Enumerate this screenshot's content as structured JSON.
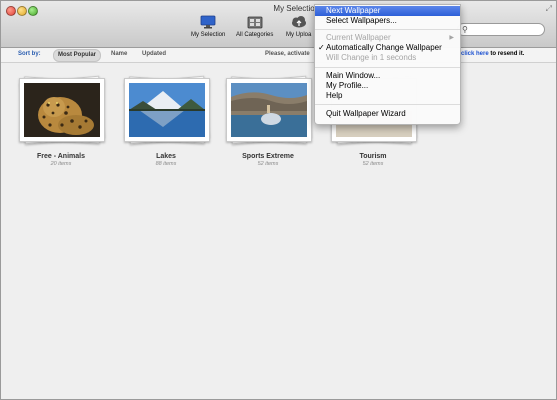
{
  "window": {
    "title": "My Selection – Wallpaper W"
  },
  "toolbar": {
    "buttons": [
      {
        "label": "My Selection",
        "icon": "monitor-icon"
      },
      {
        "label": "All Categories",
        "icon": "film-icon"
      },
      {
        "label": "My Uploa",
        "icon": "cloud-upload-icon"
      }
    ]
  },
  "search": {
    "placeholder": "",
    "icon": "search-icon"
  },
  "sortbar": {
    "label": "Sort by:",
    "options": [
      "Most Popular",
      "Name",
      "Updated"
    ],
    "active": "Most Popular",
    "notice_prefix": "Please, activate",
    "notice_link": "click here",
    "notice_suffix": "to resend it."
  },
  "categories": [
    {
      "title": "Free - Animals",
      "count": "20 items"
    },
    {
      "title": "Lakes",
      "count": "88 items"
    },
    {
      "title": "Sports Extreme",
      "count": "52 items"
    },
    {
      "title": "Tourism",
      "count": "52 items"
    }
  ],
  "menu": {
    "items": [
      {
        "label": "Next Wallpaper",
        "state": "highlighted"
      },
      {
        "label": "Select Wallpapers...",
        "state": "enabled"
      },
      {
        "label": "Current Wallpaper",
        "state": "disabled",
        "submenu": true
      },
      {
        "label": "Automatically Change Wallpaper",
        "state": "checked"
      },
      {
        "label": "Will Change in 1 seconds",
        "state": "disabled"
      },
      {
        "label": "Main Window...",
        "state": "enabled"
      },
      {
        "label": "My Profile...",
        "state": "enabled"
      },
      {
        "label": "Help",
        "state": "enabled"
      },
      {
        "label": "Quit Wallpaper Wizard",
        "state": "enabled"
      }
    ],
    "check_mark": "✓",
    "submenu_arrow": "▶"
  },
  "colors": {
    "accent": "#2d5fd8",
    "sort_label": "#2a5db0",
    "link": "#1a4fd0"
  }
}
